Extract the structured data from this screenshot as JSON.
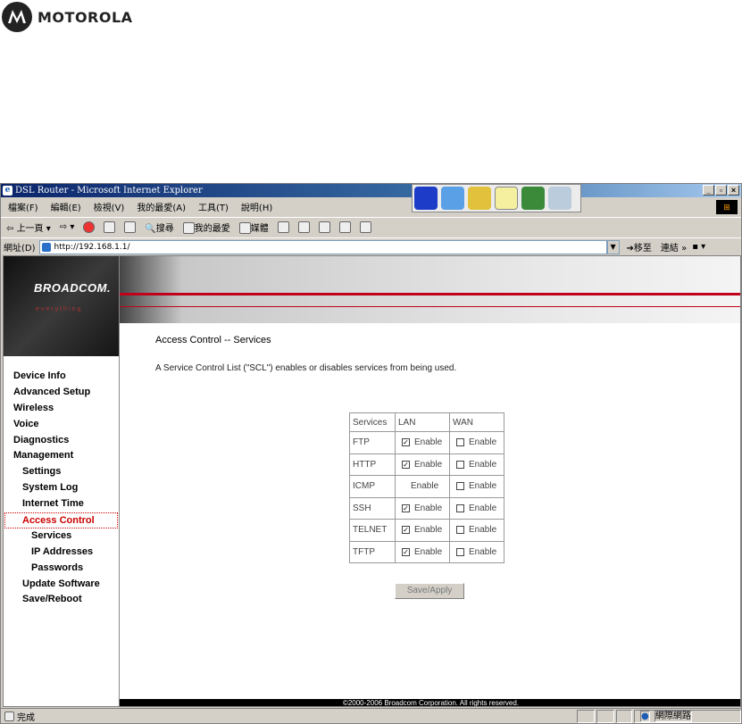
{
  "brand_header": {
    "name": "MOTOROLA"
  },
  "browser": {
    "title": "DSL Router - Microsoft Internet Explorer",
    "menu": [
      "檔案(F)",
      "編輯(E)",
      "檢視(V)",
      "我的最愛(A)",
      "工具(T)",
      "說明(H)"
    ],
    "toolbar": {
      "back": "上一頁",
      "search": "搜尋",
      "favorites": "我的最愛",
      "media": "媒體"
    },
    "address_label": "網址(D)",
    "address_value": "http://192.168.1.1/",
    "go_label": "移至",
    "links_label": "連結",
    "status_text": "完成",
    "zone_text": "網際網路"
  },
  "router": {
    "brand": "BROADCOM.",
    "tagline": "everything",
    "nav": [
      {
        "label": "Device Info",
        "level": 1
      },
      {
        "label": "Advanced Setup",
        "level": 1
      },
      {
        "label": "Wireless",
        "level": 1
      },
      {
        "label": "Voice",
        "level": 1
      },
      {
        "label": "Diagnostics",
        "level": 1
      },
      {
        "label": "Management",
        "level": 1
      },
      {
        "label": "Settings",
        "level": 2
      },
      {
        "label": "System Log",
        "level": 2
      },
      {
        "label": "Internet Time",
        "level": 2
      },
      {
        "label": "Access Control",
        "level": 2,
        "active": true
      },
      {
        "label": "Services",
        "level": 3
      },
      {
        "label": "IP Addresses",
        "level": 3
      },
      {
        "label": "Passwords",
        "level": 3
      },
      {
        "label": "Update Software",
        "level": 2
      },
      {
        "label": "Save/Reboot",
        "level": 2
      }
    ],
    "page_title": "Access Control -- Services",
    "description": "A Service Control List (\"SCL\") enables or disables services from being used.",
    "table": {
      "headers": [
        "Services",
        "LAN",
        "WAN"
      ],
      "rows": [
        {
          "service": "FTP",
          "lan_checked": true,
          "lan_text": "Enable",
          "wan_checked": false,
          "wan_text": "Enable"
        },
        {
          "service": "HTTP",
          "lan_checked": true,
          "lan_text": "Enable",
          "wan_checked": false,
          "wan_text": "Enable"
        },
        {
          "service": "ICMP",
          "lan_checked": null,
          "lan_text": "Enable",
          "wan_checked": false,
          "wan_text": "Enable"
        },
        {
          "service": "SSH",
          "lan_checked": true,
          "lan_text": "Enable",
          "wan_checked": false,
          "wan_text": "Enable"
        },
        {
          "service": "TELNET",
          "lan_checked": true,
          "lan_text": "Enable",
          "wan_checked": false,
          "wan_text": "Enable"
        },
        {
          "service": "TFTP",
          "lan_checked": true,
          "lan_text": "Enable",
          "wan_checked": false,
          "wan_text": "Enable"
        }
      ]
    },
    "apply_label": "Save/Apply",
    "footer": "©2000-2006 Broadcom Corporation. All rights reserved."
  }
}
